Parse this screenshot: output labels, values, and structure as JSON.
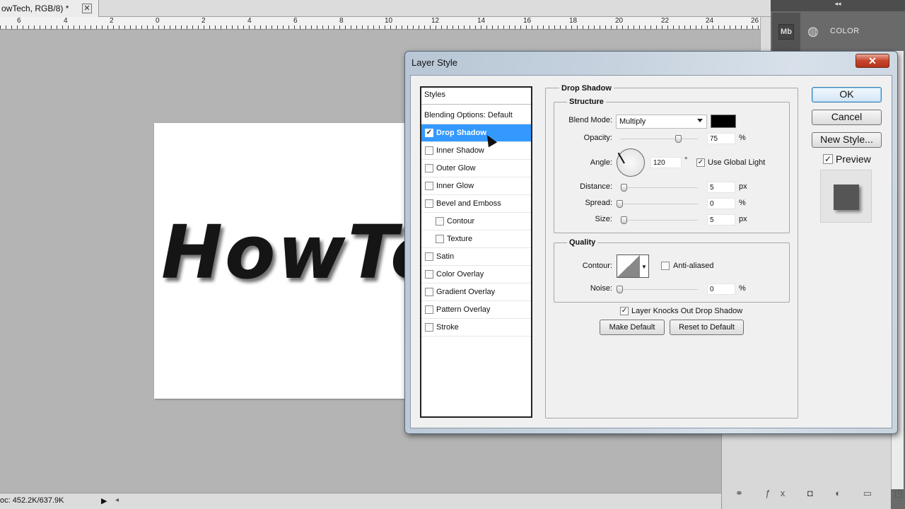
{
  "document": {
    "tab_title": "owTech, RGB/8) *",
    "close_glyph": "✕",
    "canvas_text": "HowTech",
    "status_doc_info": "oc: 452.2K/637.9K",
    "ruler_numbers": [
      "6",
      "4",
      "2",
      "0",
      "2",
      "4",
      "6",
      "8",
      "10",
      "12",
      "14",
      "16",
      "18",
      "20",
      "22",
      "24",
      "26"
    ]
  },
  "right_panel": {
    "collapse_glyph": "◂◂",
    "mb_icon_label": "Mb",
    "color_label": "COLOR"
  },
  "dialog": {
    "title": "Layer Style",
    "close_glyph": "✕",
    "styles_header": "Styles",
    "blending_options": "Blending Options: Default",
    "style_items": [
      {
        "label": "Drop Shadow",
        "checked": true,
        "selected": true
      },
      {
        "label": "Inner Shadow",
        "checked": false
      },
      {
        "label": "Outer Glow",
        "checked": false
      },
      {
        "label": "Inner Glow",
        "checked": false
      },
      {
        "label": "Bevel and Emboss",
        "checked": false
      },
      {
        "label": "Contour",
        "checked": false
      },
      {
        "label": "Texture",
        "checked": false
      },
      {
        "label": "Satin",
        "checked": false
      },
      {
        "label": "Color Overlay",
        "checked": false
      },
      {
        "label": "Gradient Overlay",
        "checked": false
      },
      {
        "label": "Pattern Overlay",
        "checked": false
      },
      {
        "label": "Stroke",
        "checked": false
      }
    ],
    "drop_shadow": {
      "section_title": "Drop Shadow",
      "structure_title": "Structure",
      "blend_mode_label": "Blend Mode:",
      "blend_mode_value": "Multiply",
      "shadow_color": "#000000",
      "opacity_label": "Opacity:",
      "opacity_value": "75",
      "opacity_unit": "%",
      "angle_label": "Angle:",
      "angle_value": "120",
      "angle_unit": "°",
      "use_global_light_label": "Use Global Light",
      "use_global_light_checked": true,
      "distance_label": "Distance:",
      "distance_value": "5",
      "distance_unit": "px",
      "spread_label": "Spread:",
      "spread_value": "0",
      "spread_unit": "%",
      "size_label": "Size:",
      "size_value": "5",
      "size_unit": "px",
      "quality_title": "Quality",
      "contour_label": "Contour:",
      "anti_aliased_label": "Anti-aliased",
      "anti_aliased_checked": false,
      "noise_label": "Noise:",
      "noise_value": "0",
      "noise_unit": "%",
      "layer_knocks_out_label": "Layer Knocks Out Drop Shadow",
      "layer_knocks_out_checked": true,
      "make_default_label": "Make Default",
      "reset_default_label": "Reset to Default"
    },
    "buttons": {
      "ok": "OK",
      "cancel": "Cancel",
      "new_style": "New Style...",
      "preview_label": "Preview",
      "preview_checked": true
    }
  }
}
